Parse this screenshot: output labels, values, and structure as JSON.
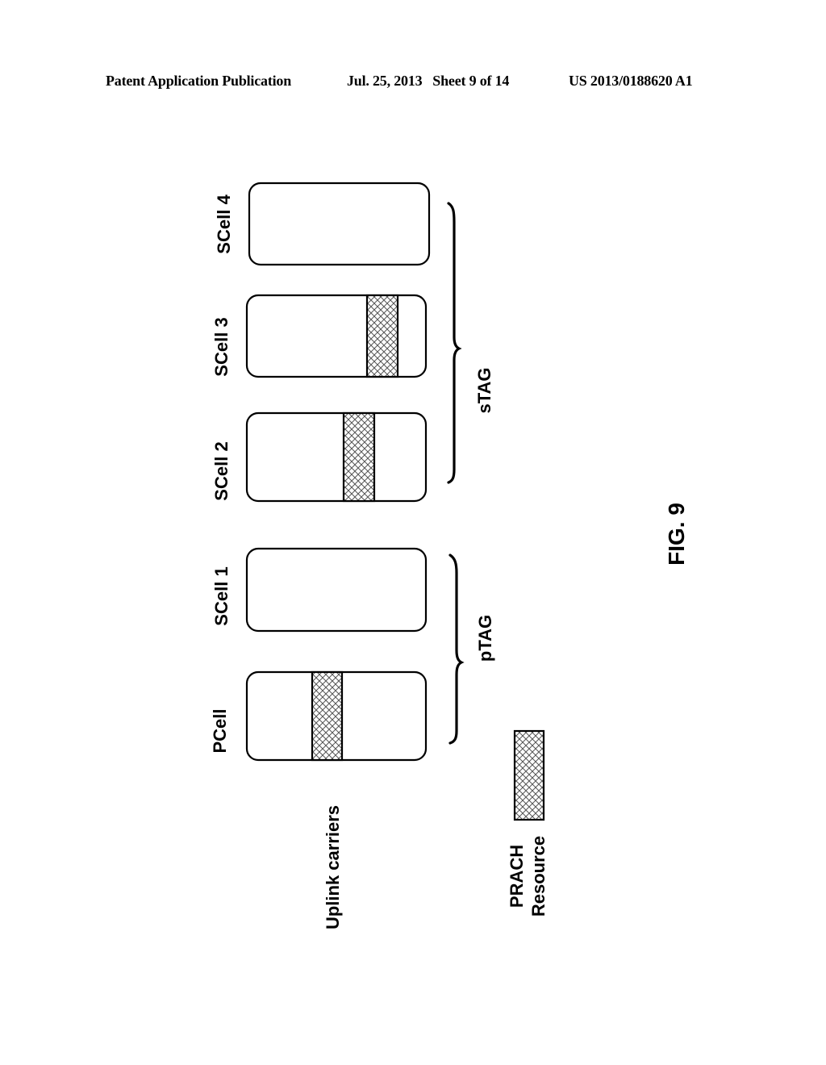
{
  "header": {
    "publication": "Patent Application Publication",
    "date_sheet": "Jul. 25, 2013   Sheet 9 of 14",
    "number": "US 2013/0188620 A1"
  },
  "figure": {
    "label": "FIG. 9",
    "row_label": "Uplink carriers",
    "carriers": [
      {
        "name": "PCell",
        "has_prach": true
      },
      {
        "name": "SCell 1",
        "has_prach": false
      },
      {
        "name": "SCell 2",
        "has_prach": true
      },
      {
        "name": "SCell 3",
        "has_prach": true
      },
      {
        "name": "SCell 4",
        "has_prach": false
      }
    ],
    "groups": [
      {
        "name": "pTAG",
        "members": [
          "PCell",
          "SCell 1"
        ]
      },
      {
        "name": "sTAG",
        "members": [
          "SCell 2",
          "SCell 3",
          "SCell 4"
        ]
      }
    ],
    "legend": {
      "line1": "PRACH",
      "line2": "Resource"
    }
  }
}
